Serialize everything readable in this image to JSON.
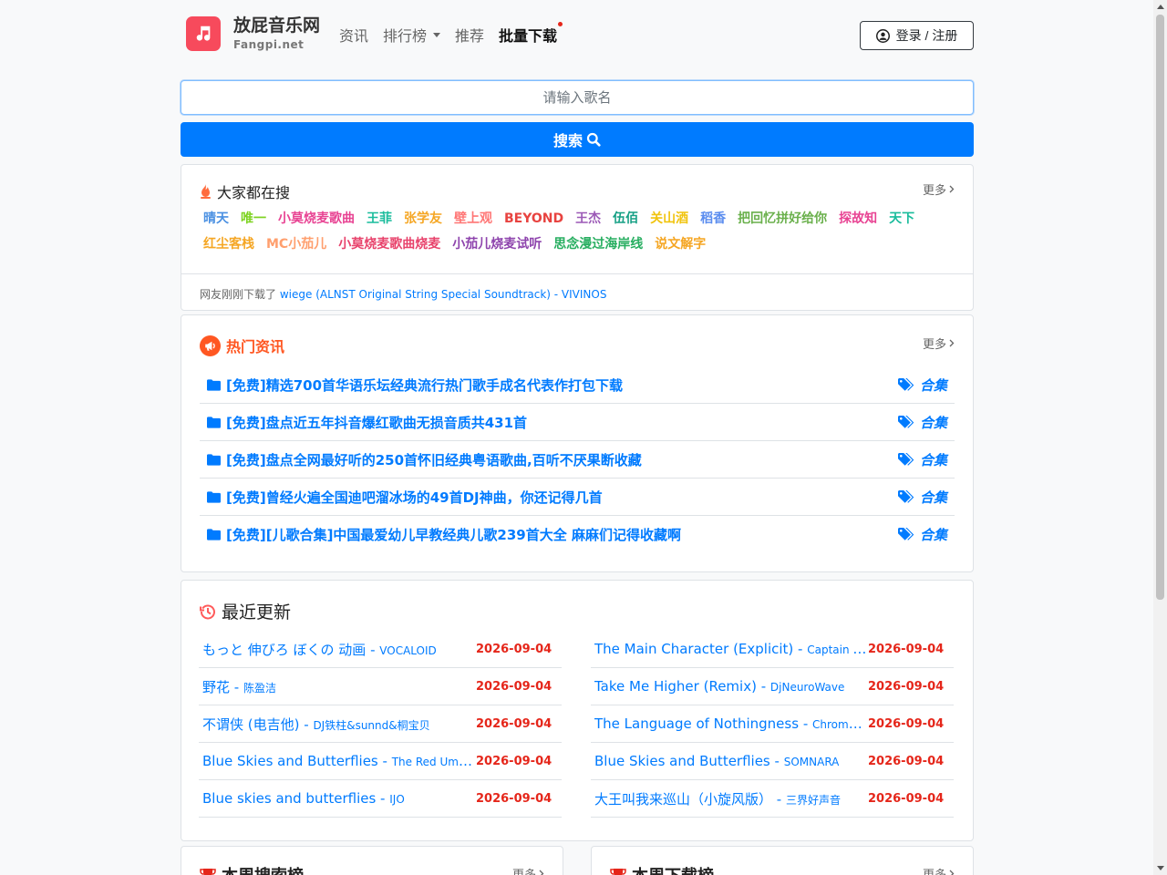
{
  "brand": {
    "title": "放屁音乐网",
    "subtitle": "Fangpi.net"
  },
  "nav": {
    "items": [
      "资讯",
      "排行榜",
      "推荐"
    ],
    "active": "批量下载"
  },
  "login": {
    "label": "登录 / 注册"
  },
  "search": {
    "placeholder": "请输入歌名",
    "button": "搜索"
  },
  "hot_search": {
    "title": "大家都在搜",
    "more": "更多",
    "tags": [
      {
        "text": "晴天",
        "color": "#4a90e2"
      },
      {
        "text": "唯一",
        "color": "#7ed321"
      },
      {
        "text": "小莫烧麦歌曲",
        "color": "#e84393"
      },
      {
        "text": "王菲",
        "color": "#1abc9c"
      },
      {
        "text": "张学友",
        "color": "#f5a623"
      },
      {
        "text": "壁上观",
        "color": "#ff7675"
      },
      {
        "text": "BEYOND",
        "color": "#e84340"
      },
      {
        "text": "王杰",
        "color": "#9b59b6"
      },
      {
        "text": "伍佰",
        "color": "#16a085"
      },
      {
        "text": "关山酒",
        "color": "#f1c40f"
      },
      {
        "text": "稻香",
        "color": "#5b8def"
      },
      {
        "text": "把回忆拼好给你",
        "color": "#6ab04c"
      },
      {
        "text": "探故知",
        "color": "#e84393"
      },
      {
        "text": "天下",
        "color": "#1abc9c"
      },
      {
        "text": "红尘客栈",
        "color": "#f5a623"
      },
      {
        "text": "MC小茄儿",
        "color": "#ff9f6e"
      },
      {
        "text": "小莫烧麦歌曲烧麦",
        "color": "#e8436c"
      },
      {
        "text": "小茄儿烧麦试听",
        "color": "#8e44ad"
      },
      {
        "text": "思念漫过海岸线",
        "color": "#27ae60"
      },
      {
        "text": "说文解字",
        "color": "#f5a623"
      }
    ],
    "recent_prefix": "网友刚刚下载了",
    "recent_song": "wiege (ALNST Original String Special Soundtrack) - VIVINOS"
  },
  "news": {
    "title": "热门资讯",
    "more": "更多",
    "tag_label": "合集",
    "items": [
      "[免费]精选700首华语乐坛经典流行热门歌手成名代表作打包下载",
      "[免费]盘点近五年抖音爆红歌曲无损音质共431首",
      "[免费]盘点全网最好听的250首怀旧经典粤语歌曲,百听不厌果断收藏",
      "[免费]曾经火遍全国迪吧溜冰场的49首DJ神曲，你还记得几首",
      "[免费][儿歌合集]中国最爱幼儿早教经典儿歌239首大全 麻麻们记得收藏啊"
    ]
  },
  "updates": {
    "title": "最近更新",
    "left": [
      {
        "song": "もっと 伸びろ ぼくの 动画",
        "artist": "VOCALOID",
        "date": "2026-09-04"
      },
      {
        "song": "野花",
        "artist": "陈盈洁",
        "date": "2026-09-04"
      },
      {
        "song": "不谓侠 (电吉他)",
        "artist": "DJ铁柱&sunnd&桐宝贝",
        "date": "2026-09-04"
      },
      {
        "song": "Blue Skies and Butterflies",
        "artist": "The Red Umbrella",
        "date": "2026-09-04"
      },
      {
        "song": "Blue skies and butterflies",
        "artist": "IJO",
        "date": "2026-09-04"
      }
    ],
    "right": [
      {
        "song": "The Main Character (Explicit)",
        "artist": "Captain Dior",
        "date": "2026-09-04"
      },
      {
        "song": "Take Me Higher (Remix)",
        "artist": "DjNeuroWave",
        "date": "2026-09-04"
      },
      {
        "song": "The Language of Nothingness",
        "artist": "Chromara ...",
        "date": "2026-09-04"
      },
      {
        "song": "Blue Skies and Butterflies",
        "artist": "SOMNARA",
        "date": "2026-09-04"
      },
      {
        "song": "大王叫我来巡山（小旋风版）",
        "artist": "三界好声音",
        "date": "2026-09-04"
      }
    ]
  },
  "weekly_search": {
    "title": "本周搜索榜",
    "more": "更多"
  },
  "weekly_download": {
    "title": "本周下载榜",
    "more": "更多"
  }
}
